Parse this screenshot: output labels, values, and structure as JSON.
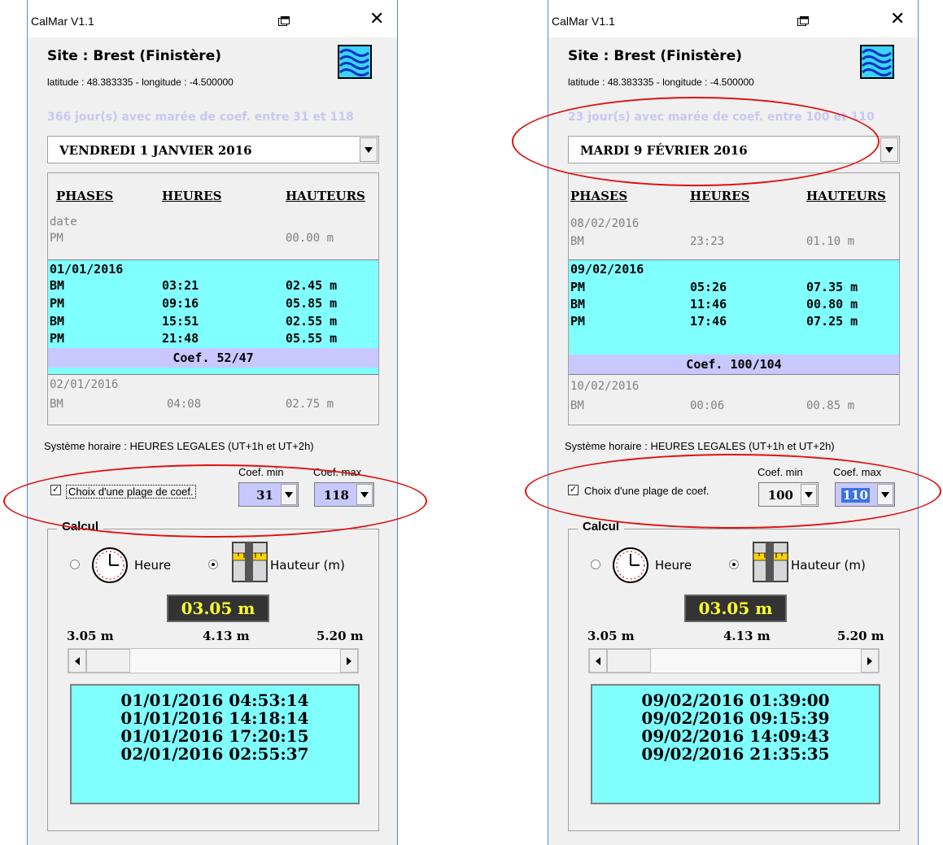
{
  "windows": [
    {
      "title": "CalMar V1.1",
      "site": "Site : Brest (Finistère)",
      "coords": "latitude : 48.383335 - longitude : -4.500000",
      "days_info": "366 jour(s) avec marée de coef. entre 31 et 118",
      "selected_date": "VENDREDI 1 JANVIER 2016",
      "headers": {
        "phases": "PHASES",
        "heures": "HEURES",
        "hauteurs": "HAUTEURS"
      },
      "prev_day": {
        "date": "date",
        "phase": "PM",
        "time": "",
        "height": "00.00 m"
      },
      "current_day": {
        "date": "01/01/2016",
        "tides": [
          {
            "phase": "BM",
            "time": "03:21",
            "height": "02.45 m"
          },
          {
            "phase": "PM",
            "time": "09:16",
            "height": "05.85 m"
          },
          {
            "phase": "BM",
            "time": "15:51",
            "height": "02.55 m"
          },
          {
            "phase": "PM",
            "time": "21:48",
            "height": "05.55 m"
          }
        ],
        "coef": "Coef. 52/47"
      },
      "next_day": {
        "date": "02/01/2016",
        "phase": "BM",
        "time": "04:08",
        "height": "02.75 m"
      },
      "system": "Système horaire : HEURES LEGALES (UT+1h et UT+2h)",
      "coef_min_label": "Coef. min",
      "coef_max_label": "Coef. max",
      "range_label": "Choix d'une plage de coef.",
      "coef_min": "31",
      "coef_max": "118",
      "calc_label": "Calcul",
      "radio_heure": "Heure",
      "radio_hauteur": "Hauteur (m)",
      "height_value": "03.05 m",
      "scale": {
        "min": "3.05 m",
        "mid": "4.13 m",
        "max": "5.20 m"
      },
      "results": [
        "01/01/2016 04:53:14",
        "01/01/2016 14:18:14",
        "01/01/2016 17:20:15",
        "02/01/2016 02:55:37"
      ]
    },
    {
      "title": "CalMar V1.1",
      "site": "Site : Brest (Finistère)",
      "coords": "latitude : 48.383335 - longitude : -4.500000",
      "days_info": "23 jour(s) avec marée de coef. entre 100 et 110",
      "selected_date": "MARDI 9 FÉVRIER 2016",
      "headers": {
        "phases": "PHASES",
        "heures": "HEURES",
        "hauteurs": "HAUTEURS"
      },
      "prev_day": {
        "date": "08/02/2016",
        "phase": "BM",
        "time": "23:23",
        "height": "01.10 m"
      },
      "current_day": {
        "date": "09/02/2016",
        "tides": [
          {
            "phase": "PM",
            "time": "05:26",
            "height": "07.35 m"
          },
          {
            "phase": "BM",
            "time": "11:46",
            "height": "00.80 m"
          },
          {
            "phase": "PM",
            "time": "17:46",
            "height": "07.25 m"
          }
        ],
        "coef": "Coef. 100/104"
      },
      "next_day": {
        "date": "10/02/2016",
        "phase": "BM",
        "time": "00:06",
        "height": "00.85 m"
      },
      "system": "Système horaire : HEURES LEGALES (UT+1h et UT+2h)",
      "coef_min_label": "Coef. min",
      "coef_max_label": "Coef. max",
      "range_label": "Choix d'une plage de coef.",
      "coef_min": "100",
      "coef_max": "110",
      "calc_label": "Calcul",
      "radio_heure": "Heure",
      "radio_hauteur": "Hauteur (m)",
      "height_value": "03.05 m",
      "scale": {
        "min": "3.05 m",
        "mid": "4.13 m",
        "max": "5.20 m"
      },
      "results": [
        "09/02/2016 01:39:00",
        "09/02/2016 09:15:39",
        "09/02/2016 14:09:43",
        "09/02/2016 21:35:35"
      ]
    }
  ],
  "colors": {
    "highlight": "#80ffff",
    "coef_bar": "#c8c8ff",
    "annotation": "#e01010",
    "display_text": "#ffff33"
  }
}
